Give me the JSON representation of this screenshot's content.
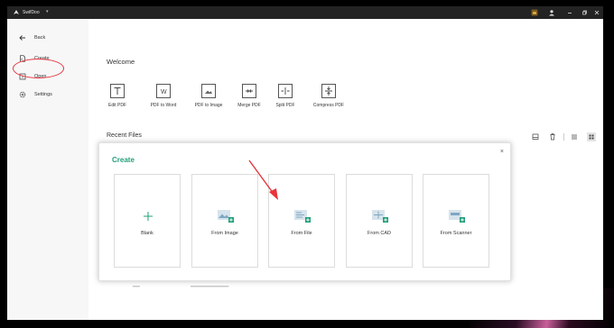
{
  "app": {
    "name": "SwifDoo",
    "caret": "▾"
  },
  "sidebar": {
    "items": [
      {
        "label": "Back",
        "icon": "arrow-left-icon"
      },
      {
        "label": "Create",
        "icon": "new-file-icon"
      },
      {
        "label": "Open",
        "icon": "open-file-icon"
      },
      {
        "label": "Settings",
        "icon": "gear-icon"
      }
    ]
  },
  "main": {
    "welcome": "Welcome",
    "tools": [
      {
        "label": "Edit PDF",
        "icon": "text-edit-icon"
      },
      {
        "label": "PDF to Word",
        "icon": "word-icon"
      },
      {
        "label": "PDF to Image",
        "icon": "image-icon"
      },
      {
        "label": "Merge PDF",
        "icon": "merge-icon"
      },
      {
        "label": "Split PDF",
        "icon": "split-icon"
      },
      {
        "label": "Compress PDF",
        "icon": "compress-icon"
      }
    ],
    "recent_files": "Recent Files"
  },
  "dialog": {
    "title": "Create",
    "close": "×",
    "options": [
      {
        "label": "Blank",
        "icon": "plus-icon"
      },
      {
        "label": "From Image",
        "icon": "image-add-icon"
      },
      {
        "label": "From File",
        "icon": "file-add-icon"
      },
      {
        "label": "From CAD",
        "icon": "cad-add-icon"
      },
      {
        "label": "From Scanner",
        "icon": "scanner-add-icon"
      }
    ]
  },
  "colors": {
    "accent": "#21a07a",
    "annotation": "#e8343b",
    "titlebar": "#232323"
  }
}
